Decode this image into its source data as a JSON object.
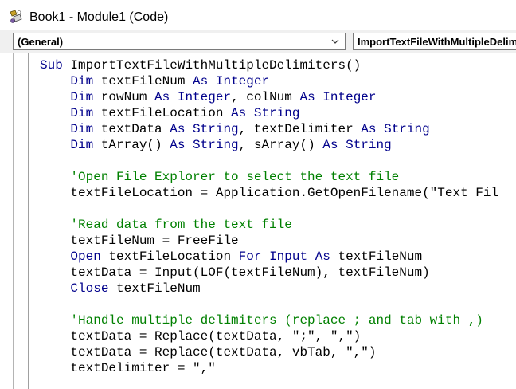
{
  "window": {
    "title": "Book1 - Module1 (Code)",
    "icon": "vba-module-icon"
  },
  "object_combo": {
    "value": "(General)"
  },
  "procedure_combo": {
    "value": "ImportTextFileWithMultipleDelimiters"
  },
  "colors": {
    "keyword": "#00008b",
    "comment": "#008000",
    "plain": "#000000",
    "toolbar_bg": "#f0f0f0"
  },
  "code": {
    "lines": [
      [
        {
          "t": "Sub",
          "k": "kw"
        },
        {
          "t": " ImportTextFileWithMultipleDelimiters()",
          "k": "p"
        }
      ],
      [
        {
          "t": "    ",
          "k": "p"
        },
        {
          "t": "Dim",
          "k": "kw"
        },
        {
          "t": " textFileNum ",
          "k": "p"
        },
        {
          "t": "As",
          "k": "kw"
        },
        {
          "t": " ",
          "k": "p"
        },
        {
          "t": "Integer",
          "k": "kw"
        }
      ],
      [
        {
          "t": "    ",
          "k": "p"
        },
        {
          "t": "Dim",
          "k": "kw"
        },
        {
          "t": " rowNum ",
          "k": "p"
        },
        {
          "t": "As",
          "k": "kw"
        },
        {
          "t": " ",
          "k": "p"
        },
        {
          "t": "Integer",
          "k": "kw"
        },
        {
          "t": ", colNum ",
          "k": "p"
        },
        {
          "t": "As",
          "k": "kw"
        },
        {
          "t": " ",
          "k": "p"
        },
        {
          "t": "Integer",
          "k": "kw"
        }
      ],
      [
        {
          "t": "    ",
          "k": "p"
        },
        {
          "t": "Dim",
          "k": "kw"
        },
        {
          "t": " textFileLocation ",
          "k": "p"
        },
        {
          "t": "As",
          "k": "kw"
        },
        {
          "t": " ",
          "k": "p"
        },
        {
          "t": "String",
          "k": "kw"
        }
      ],
      [
        {
          "t": "    ",
          "k": "p"
        },
        {
          "t": "Dim",
          "k": "kw"
        },
        {
          "t": " textData ",
          "k": "p"
        },
        {
          "t": "As",
          "k": "kw"
        },
        {
          "t": " ",
          "k": "p"
        },
        {
          "t": "String",
          "k": "kw"
        },
        {
          "t": ", textDelimiter ",
          "k": "p"
        },
        {
          "t": "As",
          "k": "kw"
        },
        {
          "t": " ",
          "k": "p"
        },
        {
          "t": "String",
          "k": "kw"
        }
      ],
      [
        {
          "t": "    ",
          "k": "p"
        },
        {
          "t": "Dim",
          "k": "kw"
        },
        {
          "t": " tArray() ",
          "k": "p"
        },
        {
          "t": "As",
          "k": "kw"
        },
        {
          "t": " ",
          "k": "p"
        },
        {
          "t": "String",
          "k": "kw"
        },
        {
          "t": ", sArray() ",
          "k": "p"
        },
        {
          "t": "As",
          "k": "kw"
        },
        {
          "t": " ",
          "k": "p"
        },
        {
          "t": "String",
          "k": "kw"
        }
      ],
      [],
      [
        {
          "t": "    ",
          "k": "p"
        },
        {
          "t": "'Open File Explorer to select the text file",
          "k": "cm"
        }
      ],
      [
        {
          "t": "    textFileLocation = Application.GetOpenFilename(\"Text Fil",
          "k": "p"
        }
      ],
      [],
      [
        {
          "t": "    ",
          "k": "p"
        },
        {
          "t": "'Read data from the text file",
          "k": "cm"
        }
      ],
      [
        {
          "t": "    textFileNum = FreeFile",
          "k": "p"
        }
      ],
      [
        {
          "t": "    ",
          "k": "p"
        },
        {
          "t": "Open",
          "k": "kw"
        },
        {
          "t": " textFileLocation ",
          "k": "p"
        },
        {
          "t": "For",
          "k": "kw"
        },
        {
          "t": " ",
          "k": "p"
        },
        {
          "t": "Input",
          "k": "kw"
        },
        {
          "t": " ",
          "k": "p"
        },
        {
          "t": "As",
          "k": "kw"
        },
        {
          "t": " textFileNum",
          "k": "p"
        }
      ],
      [
        {
          "t": "    textData = Input(LOF(textFileNum), textFileNum)",
          "k": "p"
        }
      ],
      [
        {
          "t": "    ",
          "k": "p"
        },
        {
          "t": "Close",
          "k": "kw"
        },
        {
          "t": " textFileNum",
          "k": "p"
        }
      ],
      [],
      [
        {
          "t": "    ",
          "k": "p"
        },
        {
          "t": "'Handle multiple delimiters (replace ; and tab with ,)",
          "k": "cm"
        }
      ],
      [
        {
          "t": "    textData = Replace(textData, \";\", \",\")",
          "k": "p"
        }
      ],
      [
        {
          "t": "    textData = Replace(textData, vbTab, \",\")",
          "k": "p"
        }
      ],
      [
        {
          "t": "    textDelimiter = \",\"",
          "k": "p"
        }
      ]
    ]
  }
}
